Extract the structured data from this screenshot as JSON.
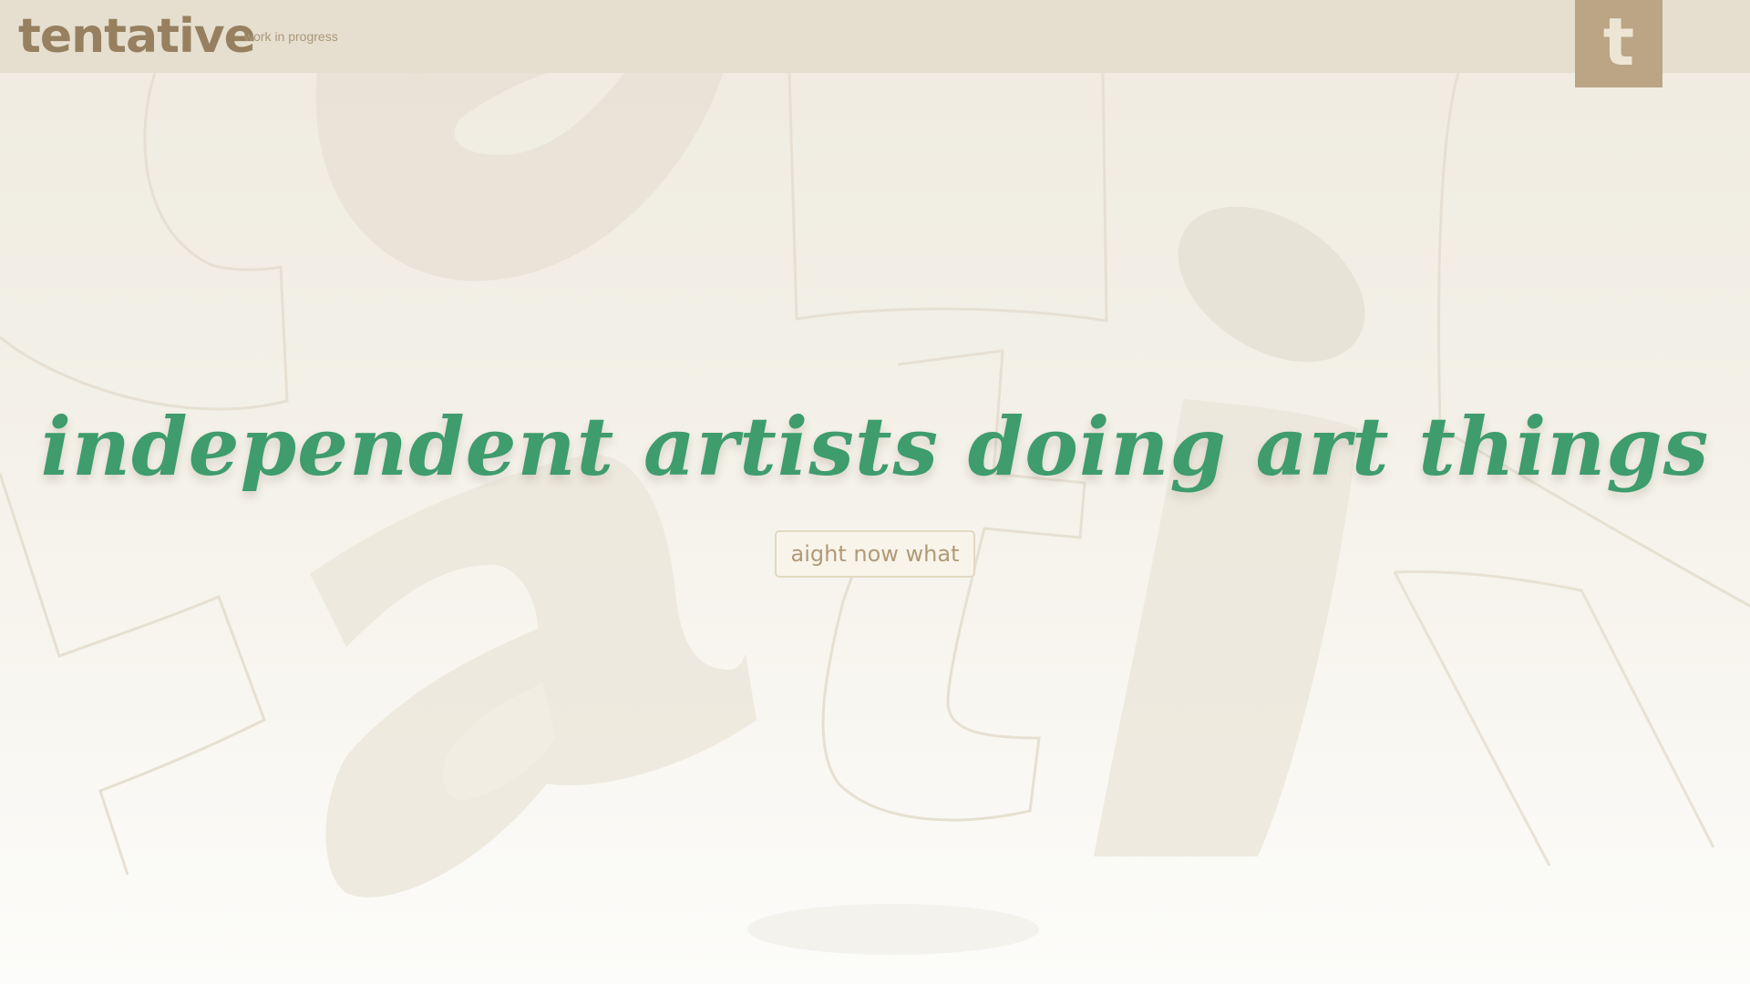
{
  "header": {
    "brand": "tentative",
    "tagline": "work in progress",
    "social_icon": "tumblr-icon",
    "social_glyph": "t"
  },
  "hero": {
    "headline": "independent artists doing art things",
    "cta_label": "aight now what"
  },
  "colors": {
    "header_bg": "#e6dfcf",
    "brand": "#96805f",
    "headline": "#3f9c6c",
    "tumblr_bg": "#bba585",
    "page_bg_top": "#efebe0",
    "page_bg_bottom": "#fcfcfa"
  }
}
